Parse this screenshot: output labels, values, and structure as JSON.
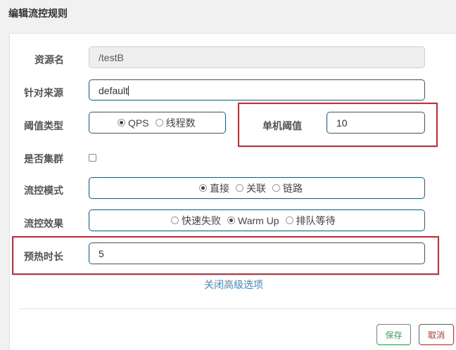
{
  "dialog": {
    "title": "编辑流控规则"
  },
  "form": {
    "resource": {
      "label": "资源名",
      "value": "/testB"
    },
    "source": {
      "label": "针对来源",
      "value": "default"
    },
    "threshold_type": {
      "label": "阈值类型",
      "options": [
        "QPS",
        "线程数"
      ],
      "selected": "QPS"
    },
    "single_threshold": {
      "label": "单机阈值",
      "value": "10"
    },
    "cluster": {
      "label": "是否集群",
      "checked": false
    },
    "flow_mode": {
      "label": "流控模式",
      "options": [
        "直接",
        "关联",
        "链路"
      ],
      "selected": "直接"
    },
    "flow_effect": {
      "label": "流控效果",
      "options": [
        "快速失败",
        "Warm Up",
        "排队等待"
      ],
      "selected": "Warm Up"
    },
    "warmup_time": {
      "label": "预热时长",
      "value": "5"
    },
    "advanced_link": "关闭高级选项"
  },
  "buttons": {
    "save": "保存",
    "cancel": "取消"
  },
  "colors": {
    "primary_border": "#1e5b96",
    "highlight": "#d9232d",
    "save": "#3aa657",
    "cancel": "#c0392b",
    "link": "#3a8bd6"
  }
}
